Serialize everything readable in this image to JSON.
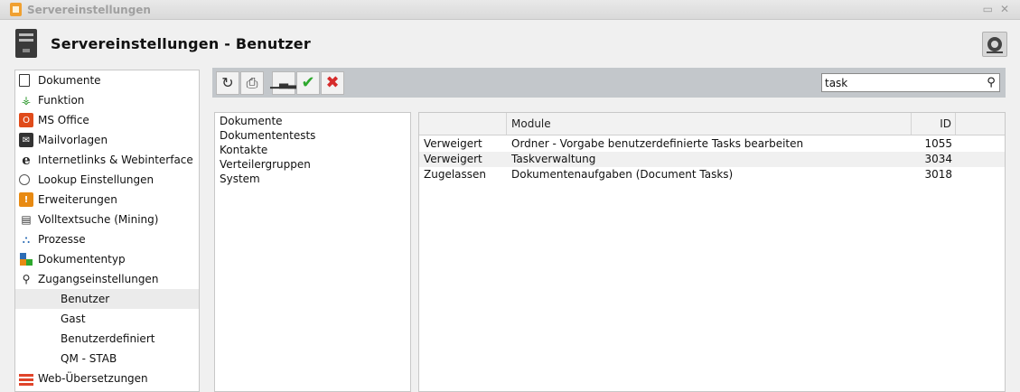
{
  "window": {
    "title": "Servereinstellungen",
    "controls": [
      "▭",
      "✕"
    ]
  },
  "header": {
    "title": "Servereinstellungen - Benutzer"
  },
  "sidebar": {
    "items": [
      {
        "label": "Dokumente",
        "icon": "document-icon"
      },
      {
        "label": "Funktion",
        "icon": "function-tree-icon"
      },
      {
        "label": "MS Office",
        "icon": "ms-office-icon"
      },
      {
        "label": "Mailvorlagen",
        "icon": "mail-template-icon"
      },
      {
        "label": "Internetlinks & Webinterface",
        "icon": "internet-explorer-icon"
      },
      {
        "label": "Lookup Einstellungen",
        "icon": "lookup-icon"
      },
      {
        "label": "Erweiterungen",
        "icon": "extension-icon"
      },
      {
        "label": "Volltextsuche (Mining)",
        "icon": "fulltext-search-icon"
      },
      {
        "label": "Prozesse",
        "icon": "process-icon"
      },
      {
        "label": "Dokumententyp",
        "icon": "document-type-icon"
      },
      {
        "label": "Zugangseinstellungen",
        "icon": "key-icon"
      },
      {
        "label": "Benutzer",
        "sub": true,
        "selected": true
      },
      {
        "label": "Gast",
        "sub": true
      },
      {
        "label": "Benutzerdefiniert",
        "sub": true
      },
      {
        "label": "QM - STAB",
        "sub": true
      },
      {
        "label": "Web-Übersetzungen",
        "icon": "web-translation-icon"
      }
    ]
  },
  "toolbar": {
    "buttons": [
      "refresh-icon",
      "print-icon",
      "chart-icon",
      "check-icon",
      "cancel-icon"
    ],
    "search_value": "task"
  },
  "categories": [
    "Dokumente",
    "Dokumententests",
    "Kontakte",
    "Verteilergruppen",
    "System"
  ],
  "grid": {
    "columns": [
      "",
      "Module",
      "ID",
      ""
    ],
    "rows": [
      {
        "status": "Verweigert",
        "module": "Ordner - Vorgabe benutzerdefinierte Tasks bearbeiten",
        "id": "1055"
      },
      {
        "status": "Verweigert",
        "module": "Taskverwaltung",
        "id": "3034"
      },
      {
        "status": "Zugelassen",
        "module": "Dokumentenaufgaben (Document Tasks)",
        "id": "3018"
      }
    ]
  },
  "colors": {
    "toolbar_bg": "#c3c7cb",
    "ok_green": "#2da82d",
    "cancel_red": "#d62b2b",
    "extension_orange": "#e88a12"
  }
}
